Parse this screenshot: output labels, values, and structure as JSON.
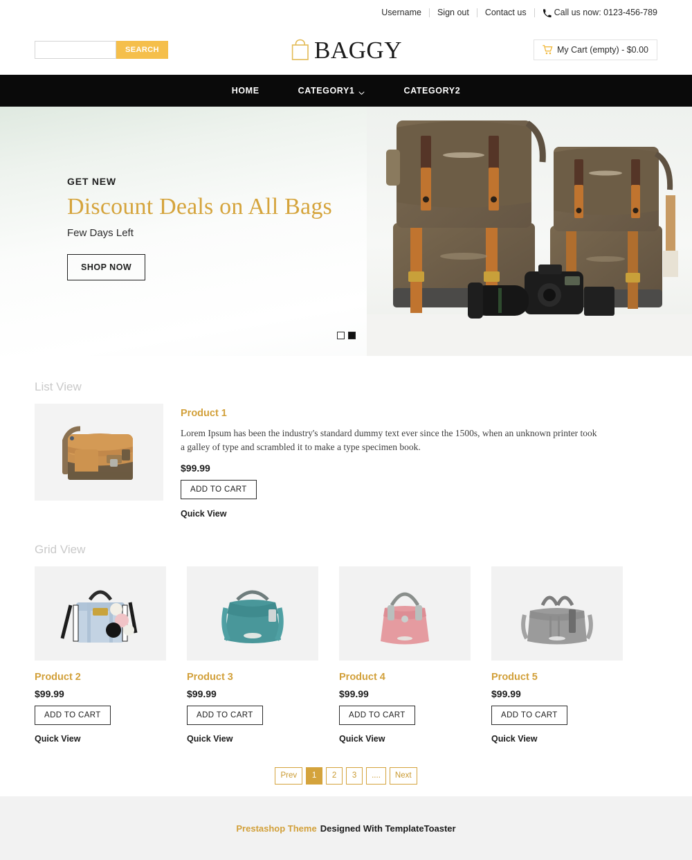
{
  "topbar": {
    "username": "Username",
    "signout": "Sign out",
    "contact": "Contact us",
    "phone_icon": "phone-icon",
    "phone": "Call us now: 0123-456-789"
  },
  "header": {
    "search_placeholder": "",
    "search_value": "",
    "search_button": "SEARCH",
    "logo_icon": "shopping-bag-icon",
    "logo_text": "BAGGY",
    "cart_icon": "shopping-cart-icon",
    "cart_label": "My Cart (empty) - $0.00"
  },
  "nav": {
    "items": [
      {
        "label": "HOME",
        "has_dropdown": false
      },
      {
        "label": "CATEGORY1",
        "has_dropdown": true
      },
      {
        "label": "CATEGORY2",
        "has_dropdown": false
      }
    ],
    "dropdown_icon": "chevron-down-icon"
  },
  "hero": {
    "kicker": "GET NEW",
    "title": "Discount Deals on All Bags",
    "subtitle": "Few Days Left",
    "button": "SHOP NOW",
    "image_alt": "brown-canvas-backpacks-with-camera",
    "slides": [
      {
        "active": false
      },
      {
        "active": true
      }
    ]
  },
  "list_section": {
    "label": "List View",
    "product": {
      "image_alt": "tan-messenger-bag",
      "title": "Product 1",
      "description": "Lorem Ipsum has been the industry's standard dummy text ever since the 1500s, when an unknown printer took a galley of type and scrambled it to make a type specimen book.",
      "price": "$99.99",
      "add_to_cart": "ADD TO CART",
      "quick_view": "Quick View"
    }
  },
  "grid_section": {
    "label": "Grid View",
    "products": [
      {
        "image_alt": "light-blue-handbag-with-pompoms",
        "title": "Product 2",
        "price": "$99.99",
        "add_to_cart": "ADD TO CART",
        "quick_view": "Quick View"
      },
      {
        "image_alt": "teal-shoulder-bag",
        "title": "Product 3",
        "price": "$99.99",
        "add_to_cart": "ADD TO CART",
        "quick_view": "Quick View"
      },
      {
        "image_alt": "pink-shoulder-bag",
        "title": "Product 4",
        "price": "$99.99",
        "add_to_cart": "ADD TO CART",
        "quick_view": "Quick View"
      },
      {
        "image_alt": "gray-satchel-bag",
        "title": "Product 5",
        "price": "$99.99",
        "add_to_cart": "ADD TO CART",
        "quick_view": "Quick View"
      }
    ]
  },
  "pagination": {
    "prev": "Prev",
    "pages": [
      "1",
      "2",
      "3",
      "...."
    ],
    "active_page": "1",
    "next": "Next"
  },
  "footer": {
    "brand": "Prestashop Theme",
    "text": "Designed With TemplateToaster"
  },
  "colors": {
    "accent_gold": "#d4a33c",
    "search_button": "#f5bf4b",
    "nav_background": "#0a0a0a",
    "product_title": "#d2a03a",
    "section_label": "#c9c9c9",
    "footer_background": "#f2f2f2"
  }
}
